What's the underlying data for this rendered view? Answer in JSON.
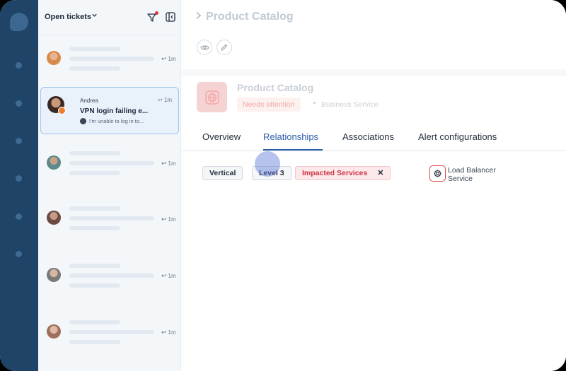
{
  "list": {
    "title": "Open tickets",
    "time_label": "1m",
    "active_ticket": {
      "name": "Andrea",
      "time": "1m",
      "subject": "VPN login failing e...",
      "preview": "I'm unable to log in to..."
    }
  },
  "main": {
    "breadcrumb_title": "Product Catalog",
    "service": {
      "title": "Product Catalog",
      "status": "Needs attention",
      "type": "Business Service"
    },
    "tabs": [
      "Overview",
      "Relationships",
      "Associations",
      "Alert configurations"
    ],
    "active_tab": "Relationships",
    "chips": {
      "vertical": "Vertical",
      "level": "Level 3",
      "impacted": "Impacted Services",
      "close": "✕"
    },
    "node": {
      "label_line1": "Load Balancer",
      "label_line2": "Service"
    }
  },
  "colors": {
    "rail": "#1f4468",
    "accent": "#2c5faa",
    "danger": "#cc3344"
  }
}
